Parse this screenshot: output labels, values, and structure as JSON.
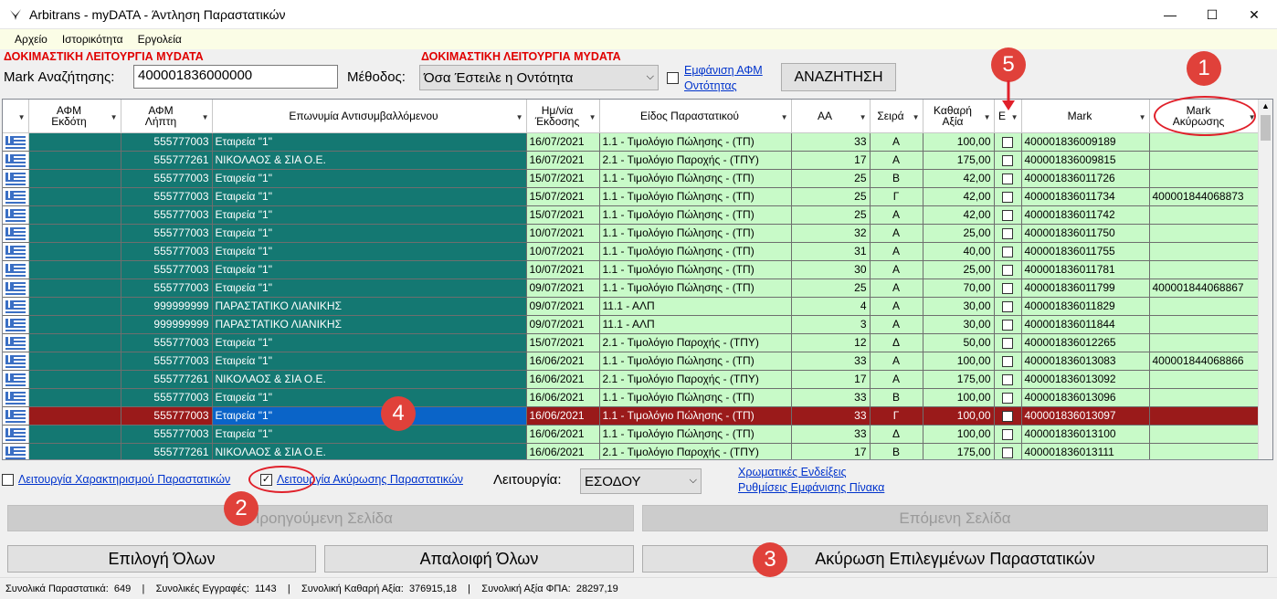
{
  "window": {
    "title": "Arbitrans - myDATA - Άντληση Παραστατικών",
    "minimize": "—",
    "maximize": "☐",
    "close": "✕"
  },
  "menu": [
    "Αρχείο",
    "Ιστορικότητα",
    "Εργολεία"
  ],
  "test_mode_caption_left": "ΔΟΚΙΜΑΣΤΙΚΗ ΛΕΙΤΟΥΡΓΙΑ MYDATA",
  "test_mode_caption_right": "ΔΟΚΙΜΑΣΤΙΚΗ ΛΕΙΤΟΥΡΓΙΑ MYDATA",
  "search": {
    "mark_label": "Mark Αναζήτησης:",
    "mark_value": "400001836000000",
    "method_label": "Μέθοδος:",
    "method_value": "Όσα Έστειλε η Οντότητα",
    "show_afm_link_1": "Εμφάνιση ΑΦΜ",
    "show_afm_link_2": "Οντότητας",
    "search_button": "ΑΝΑΖΗΤΗΣΗ"
  },
  "columns": {
    "afm_issuer_1": "ΑΦΜ",
    "afm_issuer_2": "Εκδότη",
    "afm_receiver_1": "ΑΦΜ",
    "afm_receiver_2": "Λήπτη",
    "name": "Επωνυμία Αντισυμβαλλόμενου",
    "date_1": "Ημ/νία",
    "date_2": "Έκδοσης",
    "type": "Είδος Παραστατικού",
    "aa": "ΑΑ",
    "series": "Σειρά",
    "net_1": "Καθαρή",
    "net_2": "Αξία",
    "e": "E",
    "mark": "Mark",
    "cancel_mark_1": "Mark",
    "cancel_mark_2": "Ακύρωσης"
  },
  "rows": [
    {
      "afm": "555777003",
      "name": "Εταιρεία \"1\"",
      "date": "16/07/2021",
      "type": "1.1 - Τιμολόγιο Πώλησης - (ΤΠ)",
      "aa": "33",
      "series": "Α",
      "net": "100,00",
      "mark": "400001836009189",
      "cancel": ""
    },
    {
      "afm": "555777261",
      "name": "ΝΙΚΟΛΑΟΣ & ΣΙΑ Ο.Ε.",
      "date": "16/07/2021",
      "type": "2.1 - Τιμολόγιο Παροχής - (ΤΠΥ)",
      "aa": "17",
      "series": "Α",
      "net": "175,00",
      "mark": "400001836009815",
      "cancel": ""
    },
    {
      "afm": "555777003",
      "name": "Εταιρεία \"1\"",
      "date": "15/07/2021",
      "type": "1.1 - Τιμολόγιο Πώλησης - (ΤΠ)",
      "aa": "25",
      "series": "Β",
      "net": "42,00",
      "mark": "400001836011726",
      "cancel": ""
    },
    {
      "afm": "555777003",
      "name": "Εταιρεία \"1\"",
      "date": "15/07/2021",
      "type": "1.1 - Τιμολόγιο Πώλησης - (ΤΠ)",
      "aa": "25",
      "series": "Γ",
      "net": "42,00",
      "mark": "400001836011734",
      "cancel": "400001844068873"
    },
    {
      "afm": "555777003",
      "name": "Εταιρεία \"1\"",
      "date": "15/07/2021",
      "type": "1.1 - Τιμολόγιο Πώλησης - (ΤΠ)",
      "aa": "25",
      "series": "Α",
      "net": "42,00",
      "mark": "400001836011742",
      "cancel": ""
    },
    {
      "afm": "555777003",
      "name": "Εταιρεία \"1\"",
      "date": "10/07/2021",
      "type": "1.1 - Τιμολόγιο Πώλησης - (ΤΠ)",
      "aa": "32",
      "series": "Α",
      "net": "25,00",
      "mark": "400001836011750",
      "cancel": ""
    },
    {
      "afm": "555777003",
      "name": "Εταιρεία \"1\"",
      "date": "10/07/2021",
      "type": "1.1 - Τιμολόγιο Πώλησης - (ΤΠ)",
      "aa": "31",
      "series": "Α",
      "net": "40,00",
      "mark": "400001836011755",
      "cancel": ""
    },
    {
      "afm": "555777003",
      "name": "Εταιρεία \"1\"",
      "date": "10/07/2021",
      "type": "1.1 - Τιμολόγιο Πώλησης - (ΤΠ)",
      "aa": "30",
      "series": "Α",
      "net": "25,00",
      "mark": "400001836011781",
      "cancel": ""
    },
    {
      "afm": "555777003",
      "name": "Εταιρεία \"1\"",
      "date": "09/07/2021",
      "type": "1.1 - Τιμολόγιο Πώλησης - (ΤΠ)",
      "aa": "25",
      "series": "Α",
      "net": "70,00",
      "mark": "400001836011799",
      "cancel": "400001844068867"
    },
    {
      "afm": "999999999",
      "name": "ΠΑΡΑΣΤΑΤΙΚΟ ΛΙΑΝΙΚΗΣ",
      "date": "09/07/2021",
      "type": "11.1 - ΑΛΠ",
      "aa": "4",
      "series": "Α",
      "net": "30,00",
      "mark": "400001836011829",
      "cancel": ""
    },
    {
      "afm": "999999999",
      "name": "ΠΑΡΑΣΤΑΤΙΚΟ ΛΙΑΝΙΚΗΣ",
      "date": "09/07/2021",
      "type": "11.1 - ΑΛΠ",
      "aa": "3",
      "series": "Α",
      "net": "30,00",
      "mark": "400001836011844",
      "cancel": ""
    },
    {
      "afm": "555777003",
      "name": "Εταιρεία \"1\"",
      "date": "15/07/2021",
      "type": "2.1 - Τιμολόγιο Παροχής - (ΤΠΥ)",
      "aa": "12",
      "series": "Δ",
      "net": "50,00",
      "mark": "400001836012265",
      "cancel": ""
    },
    {
      "afm": "555777003",
      "name": "Εταιρεία \"1\"",
      "date": "16/06/2021",
      "type": "1.1 - Τιμολόγιο Πώλησης - (ΤΠ)",
      "aa": "33",
      "series": "Α",
      "net": "100,00",
      "mark": "400001836013083",
      "cancel": "400001844068866"
    },
    {
      "afm": "555777261",
      "name": "ΝΙΚΟΛΑΟΣ & ΣΙΑ Ο.Ε.",
      "date": "16/06/2021",
      "type": "2.1 - Τιμολόγιο Παροχής - (ΤΠΥ)",
      "aa": "17",
      "series": "Α",
      "net": "175,00",
      "mark": "400001836013092",
      "cancel": ""
    },
    {
      "afm": "555777003",
      "name": "Εταιρεία \"1\"",
      "date": "16/06/2021",
      "type": "1.1 - Τιμολόγιο Πώλησης - (ΤΠ)",
      "aa": "33",
      "series": "Β",
      "net": "100,00",
      "mark": "400001836013096",
      "cancel": ""
    },
    {
      "afm": "555777003",
      "name": "Εταιρεία \"1\"",
      "date": "16/06/2021",
      "type": "1.1 - Τιμολόγιο Πώλησης - (ΤΠ)",
      "aa": "33",
      "series": "Γ",
      "net": "100,00",
      "mark": "400001836013097",
      "cancel": "",
      "selected": true
    },
    {
      "afm": "555777003",
      "name": "Εταιρεία \"1\"",
      "date": "16/06/2021",
      "type": "1.1 - Τιμολόγιο Πώλησης - (ΤΠ)",
      "aa": "33",
      "series": "Δ",
      "net": "100,00",
      "mark": "400001836013100",
      "cancel": ""
    },
    {
      "afm": "555777261",
      "name": "ΝΙΚΟΛΑΟΣ & ΣΙΑ Ο.Ε.",
      "date": "16/06/2021",
      "type": "2.1 - Τιμολόγιο Παροχής - (ΤΠΥ)",
      "aa": "17",
      "series": "Β",
      "net": "175,00",
      "mark": "400001836013111",
      "cancel": ""
    }
  ],
  "options": {
    "characterization_link": "Λειτουργία Χαρακτηρισμού Παραστατικών",
    "cancellation_link": "Λειτουργία Ακύρωσης Παραστατικών",
    "mode_label": "Λειτουργία:",
    "mode_value": "ΕΣΟΔΟΥ",
    "color_hints_link": "Χρωματικές Ενδείξεις",
    "table_settings_link": "Ρυθμίσεις Εμφάνισης Πίνακα"
  },
  "buttons": {
    "prev_page": "Προηγούμενη Σελίδα",
    "next_page": "Επόμενη Σελίδα",
    "select_all": "Επιλογή Όλων",
    "clear_all": "Απαλοιφή Όλων",
    "cancel_selected": "Ακύρωση Επιλεγμένων Παραστατικών"
  },
  "status": {
    "total_docs_label": "Συνολικά Παραστατικά:",
    "total_docs": "649",
    "total_records_label": "Συνολικές Εγγραφές:",
    "total_records": "1143",
    "total_net_label": "Συνολική Καθαρή Αξία:",
    "total_net": "376915,18",
    "total_vat_label": "Συνολική Αξία ΦΠΑ:",
    "total_vat": "28297,19",
    "separator": "|"
  },
  "callouts": [
    "1",
    "2",
    "3",
    "4",
    "5"
  ],
  "colors": {
    "teal": "#147872",
    "light_green": "#c8fac8",
    "selected_row": "#9a1a1a",
    "selected_cell": "#0a64c8",
    "callout": "#e0413a",
    "test_caption": "#e00000"
  }
}
